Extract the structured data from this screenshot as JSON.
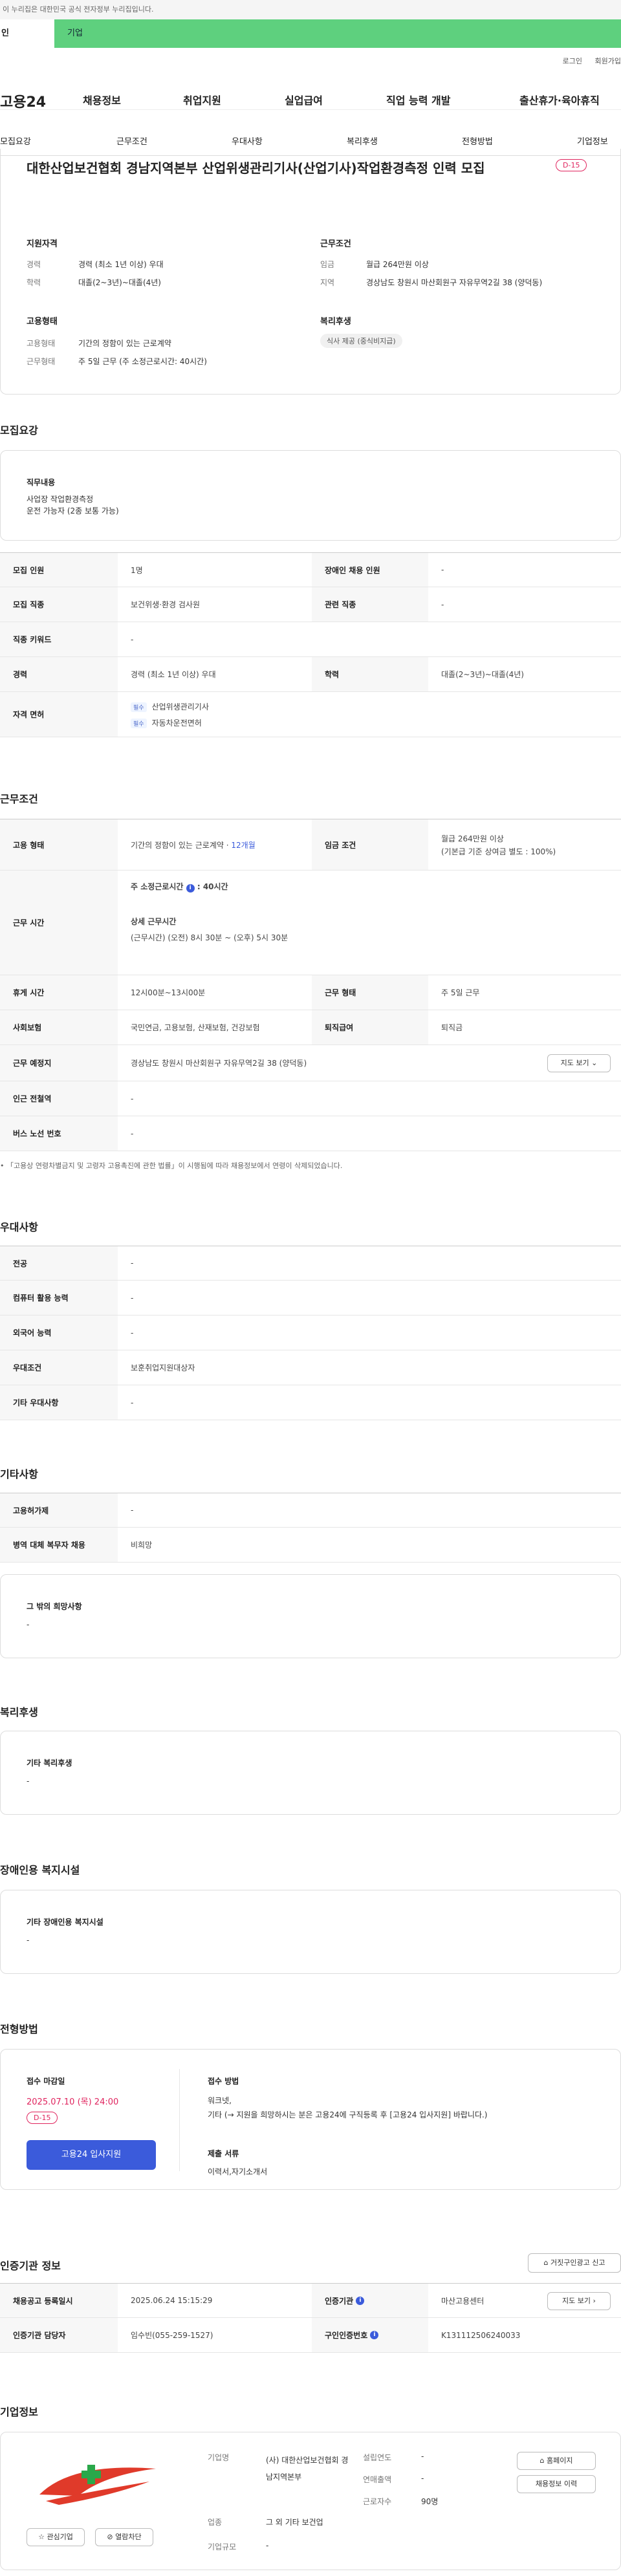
{
  "gov_banner": "이 누리집은 대한민국 공식 전자정부 누리집입니다.",
  "segment": {
    "personal": "인",
    "company": "기업"
  },
  "util": {
    "login": "로그인",
    "signup": "회원가입"
  },
  "gnb": {
    "logo": "고용24",
    "menu": [
      "채용정보",
      "취업지원",
      "실업급여",
      "직업 능력 개발",
      "출산휴가·육아휴직"
    ]
  },
  "tabs": [
    "모집요강",
    "근무조건",
    "우대사항",
    "복리후생",
    "전형방법",
    "기업정보"
  ],
  "job": {
    "title": "대한산업보건협회 경남지역본부 산업위생관리기사(산업기사)작업환경측정 인력 모집",
    "dday": "D-15",
    "qual_title": "지원자격",
    "qual": [
      {
        "k": "경력",
        "v": "경력 (최소 1년 이상) 우대"
      },
      {
        "k": "학력",
        "v": "대졸(2~3년)~대졸(4년)"
      }
    ],
    "cond_title": "근무조건",
    "cond": [
      {
        "k": "임금",
        "v": "월급 264만원 이상"
      },
      {
        "k": "지역",
        "v": "경상남도 창원시 마산회원구 자유무역2길 38 (양덕동)"
      }
    ],
    "type_title": "고용형태",
    "type": [
      {
        "k": "고용형태",
        "v": "기간의 정함이 있는 근로계약"
      },
      {
        "k": "근무형태",
        "v": "주 5일 근무 (주 소정근로시간: 40시간)"
      }
    ],
    "welfare_title": "복리후생",
    "welfare_tag": "식사 제공 (중식비지급)"
  },
  "recruit": {
    "heading": "모집요강",
    "duty_label": "직무내용",
    "duty_lines": [
      "사업장 작업환경측정",
      "운전 가능자 (2종 보통 가능)"
    ],
    "rows": [
      {
        "k1": "모집 인원",
        "v1": "1명",
        "k2": "장애인 채용 인원",
        "v2": "-"
      },
      {
        "k1": "모집 직종",
        "v1": "보건위생·환경 검사원",
        "k2": "관련 직종",
        "v2": "-"
      },
      {
        "k1": "직종 키워드",
        "v1": "-"
      },
      {
        "k1": "경력",
        "v1": "경력 (최소 1년 이상) 우대",
        "k2": "학력",
        "v2": "대졸(2~3년)~대졸(4년)"
      }
    ],
    "license_label": "자격 면허",
    "license_chip": "필수",
    "licenses": [
      "산업위생관리기사",
      "자동차운전면허"
    ]
  },
  "work": {
    "heading": "근무조건",
    "emp_type_label": "고용 형태",
    "emp_type_value": "기간의 정함이 있는 근로계약 ·",
    "emp_type_months": "12개월",
    "wage_label": "임금 조건",
    "wage_lines": [
      "월급 264만원 이상",
      "(기본급 기준 상여금 별도 : 100%)"
    ],
    "hours_label": "근무 시간",
    "hours_main": "주 소정근로시간",
    "hours_main_value": ": 40시간",
    "hours_detail_title": "상세 근무시간",
    "hours_detail": "(근무시간) (오전) 8시 30분 ~ (오후) 5시 30분",
    "rows": [
      {
        "k1": "휴게 시간",
        "v1": "12시00분~13시00분",
        "k2": "근무 형태",
        "v2": "주 5일 근무"
      },
      {
        "k1": "사회보험",
        "v1": "국민연금, 고용보험, 산재보험, 건강보험",
        "k2": "퇴직급여",
        "v2": "퇴직금"
      }
    ],
    "location_label": "근무 예정지",
    "location_value": "경상남도 창원시 마산회원구 자유무역2길 38 (양덕동)",
    "map_button": "지도 보기",
    "subway_label": "인근 전철역",
    "subway_value": "-",
    "bus_label": "버스 노선 번호",
    "bus_value": "-",
    "note": "「고용상 연령차별금지 및 고령자 고용촉진에 관한 법률」이 시행됨에 따라 채용정보에서 연령이 삭제되었습니다."
  },
  "pref": {
    "heading": "우대사항",
    "rows": [
      {
        "k": "전공",
        "v": "-"
      },
      {
        "k": "컴퓨터 활용 능력",
        "v": "-"
      },
      {
        "k": "외국어 능력",
        "v": "-"
      },
      {
        "k": "우대조건",
        "v": "보훈취업지원대상자"
      },
      {
        "k": "기타 우대사항",
        "v": "-"
      }
    ]
  },
  "etc": {
    "heading": "기타사항",
    "rows": [
      {
        "k": "고용허가제",
        "v": "-"
      },
      {
        "k": "병역 대체 복무자 채용",
        "v": "비희망"
      }
    ],
    "wish_label": "그 밖의 희망사항",
    "wish_value": "-"
  },
  "benefit": {
    "heading": "복리후생",
    "label": "기타 복리후생",
    "value": "-"
  },
  "facility": {
    "heading": "장애인용 복지시설",
    "label": "기타 장애인용 복지시설",
    "value": "-"
  },
  "apply": {
    "heading": "전형방법",
    "deadline_label": "접수 마감일",
    "deadline": "2025.07.10 (목) 24:00",
    "dday": "D-15",
    "apply_button": "고용24 입사지원",
    "method_label": "접수 방법",
    "method_lines": [
      "워크넷,",
      "기타 (→ 지원을 희망하시는 분은 고용24에 구직등록 후 [고용24 입사지원] 바랍니다.)"
    ],
    "docs_label": "제출 서류",
    "docs_value": "이력서,자기소개서"
  },
  "cert": {
    "heading": "인증기관 정보",
    "report_button": "거짓구인광고 신고",
    "r1": {
      "k1": "채용공고 등록일시",
      "v1": "2025.06.24 15:15:29",
      "k2": "인증기관",
      "v2": "마산고용센터",
      "btn": "지도 보기"
    },
    "r2": {
      "k1": "인증기관 담당자",
      "v1": "임수빈(055-259-1527)",
      "k2": "구인인증번호",
      "v2": "K131112506240033"
    }
  },
  "company": {
    "heading": "기업정보",
    "fav_button": "관심기업",
    "block_button": "열람차단",
    "name_label": "기업명",
    "name_value": "(사) 대한산업보건협회 경남지역본부",
    "industry_label": "업종",
    "industry_value": "그 외 기타 보건업",
    "size_label": "기업규모",
    "size_value": "-",
    "founded_label": "설립연도",
    "founded_value": "-",
    "revenue_label": "연매출액",
    "revenue_value": "-",
    "employees_label": "근로자수",
    "employees_value": "90명",
    "homepage_button": "홈페이지",
    "history_button": "채용정보 이력",
    "accent": "#e0245e",
    "brand_green": "#5ed07e",
    "primary_blue": "#3b5bdb"
  }
}
